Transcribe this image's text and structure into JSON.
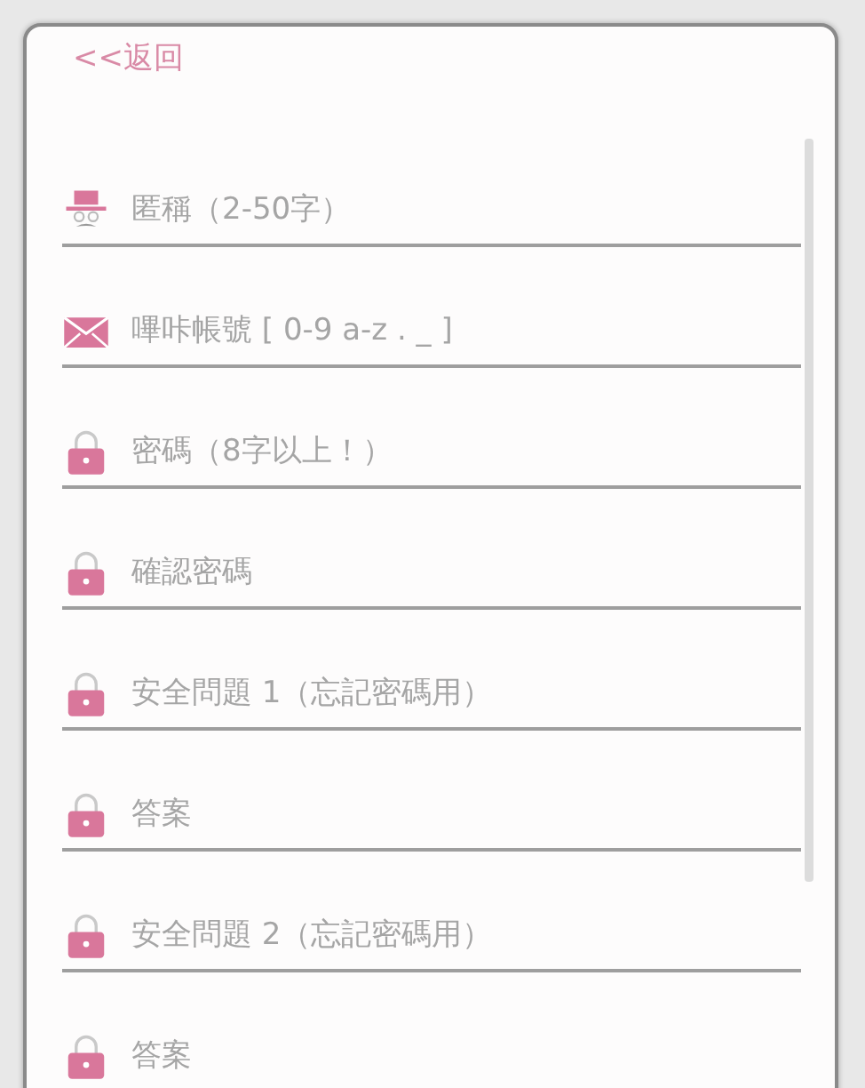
{
  "back_link": {
    "label": "<<返回"
  },
  "fields": [
    {
      "kind": "user",
      "placeholder": "匿稱（2-50字）"
    },
    {
      "kind": "mail",
      "placeholder": "嗶咔帳號 [ 0-9 a-z . _ ]"
    },
    {
      "kind": "lock",
      "placeholder": "密碼（8字以上！）"
    },
    {
      "kind": "lock",
      "placeholder": "確認密碼"
    },
    {
      "kind": "lock",
      "placeholder": "安全問題 1（忘記密碼用）"
    },
    {
      "kind": "lock",
      "placeholder": "答案"
    },
    {
      "kind": "lock",
      "placeholder": "安全問題 2（忘記密碼用）"
    },
    {
      "kind": "lock",
      "placeholder": "答案"
    }
  ]
}
